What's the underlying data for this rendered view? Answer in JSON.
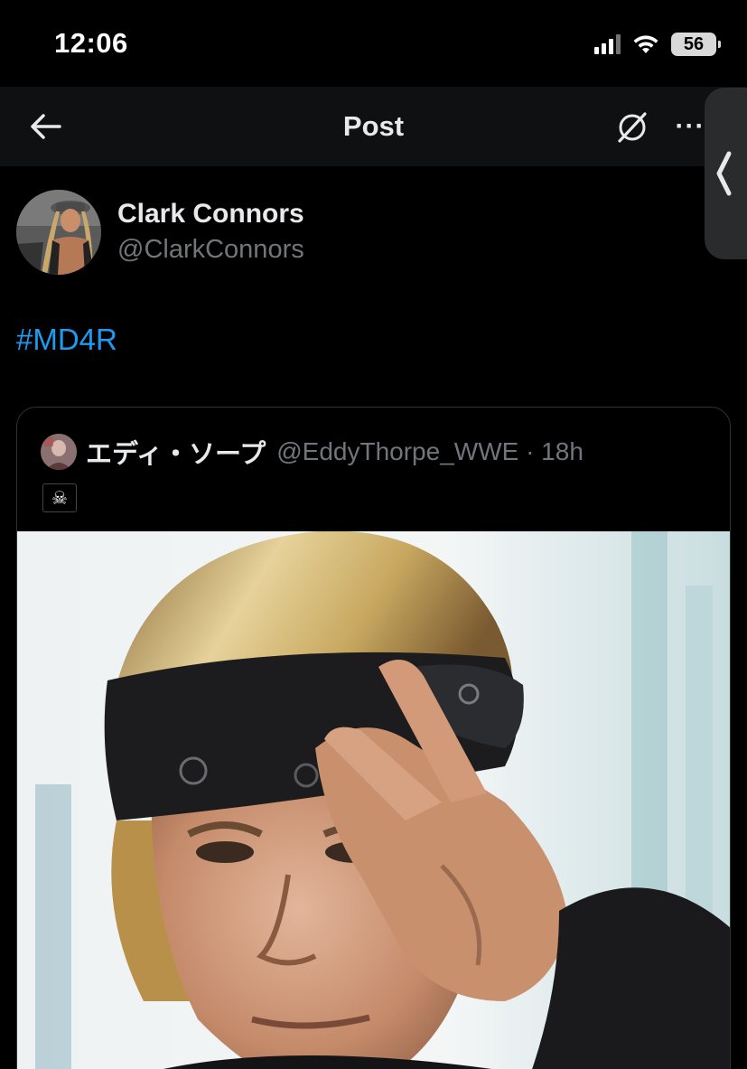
{
  "status_bar": {
    "time": "12:06",
    "battery": "56",
    "icons": [
      "cellular-signal-icon",
      "wifi-icon",
      "battery-icon"
    ]
  },
  "nav": {
    "title": "Post",
    "back_icon": "arrow-left-icon",
    "grok_icon": "grok-icon",
    "more_label": "···"
  },
  "post": {
    "author_name": "Clark Connors",
    "author_handle": "@ClarkConnors",
    "text": "#MD4R"
  },
  "quote": {
    "author_name": "エディ・ソープ",
    "meta": "@EddyThorpe_WWE · 18h",
    "flag": "☠"
  },
  "colors": {
    "background": "#000000",
    "nav_background": "#0f1012",
    "link": "#1d9bf0",
    "secondary_text": "#71767b",
    "primary_text": "#e7e9ea",
    "border": "#2f3336"
  }
}
